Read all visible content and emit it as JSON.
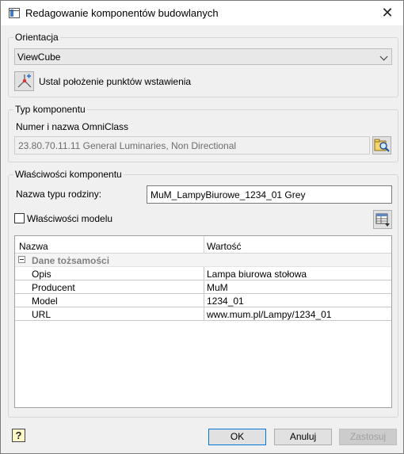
{
  "window": {
    "title": "Redagowanie komponentów budowlanych",
    "close_glyph": "✕"
  },
  "orientation": {
    "legend": "Orientacja",
    "selected": "ViewCube",
    "insertion_points_label": "Ustal położenie punktów wstawienia"
  },
  "component_type": {
    "legend": "Typ komponentu",
    "omniclass_label": "Numer i nazwa OmniClass",
    "omniclass_value": "23.80.70.11.11  General Luminaries, Non Directional"
  },
  "component_properties": {
    "legend": "Właściwości komponentu",
    "family_type_label": "Nazwa typu rodziny:",
    "family_type_value": "MuM_LampyBiurowe_1234_01 Grey",
    "model_properties_label": "Właściwości modelu",
    "model_properties_checked": false,
    "grid": {
      "columns": [
        "Nazwa",
        "Wartość"
      ],
      "group_label": "Dane tożsamości",
      "rows": [
        {
          "name": "Opis",
          "value": "Lampa biurowa stołowa"
        },
        {
          "name": "Producent",
          "value": "MuM"
        },
        {
          "name": "Model",
          "value": "1234_01"
        },
        {
          "name": "URL",
          "value": "www.mum.pl/Lampy/1234_01"
        }
      ]
    }
  },
  "footer": {
    "ok_label": "OK",
    "cancel_label": "Anuluj",
    "apply_label": "Zastosuj"
  },
  "icons": [
    "app-window-icon",
    "close-icon",
    "chevron-down-icon",
    "insertion-point-icon",
    "browse-catalog-icon",
    "table-settings-icon",
    "help-icon"
  ]
}
